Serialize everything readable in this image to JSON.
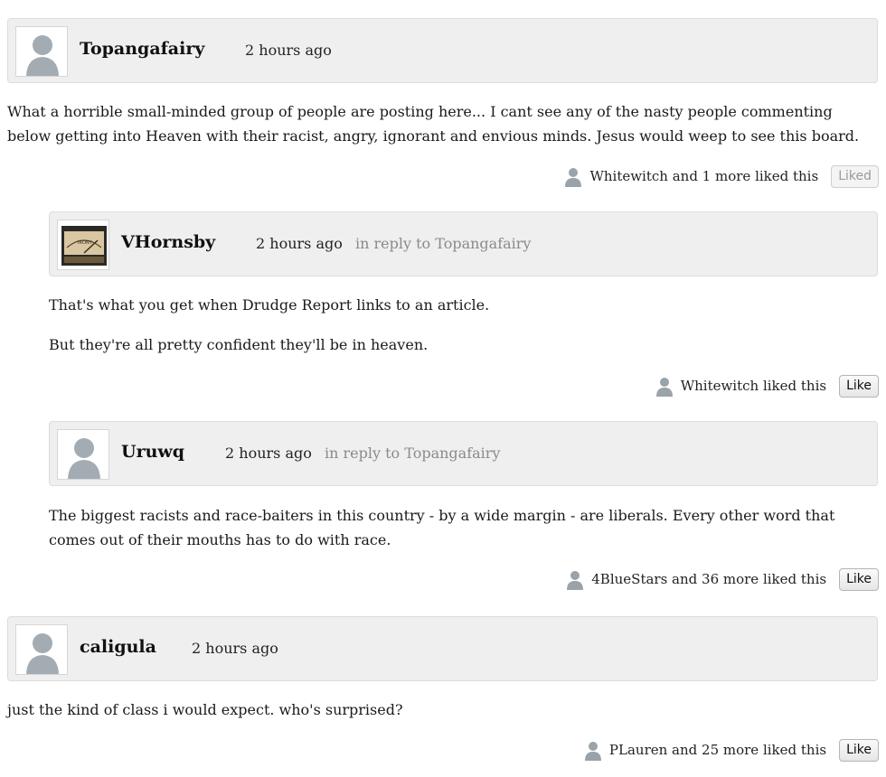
{
  "comments": [
    {
      "author": "Topangafairy",
      "time": "2 hours ago",
      "reply_to": "",
      "paragraphs": [
        "What a horrible small-minded  group of people are posting here...   I cant see any of the nasty people commenting below getting into Heaven with their racist, angry, ignorant and envious minds.   Jesus would weep to see this board."
      ],
      "likes_text": "Whitewitch and 1 more liked this",
      "like_button": "Liked",
      "avatar_icon": "default-avatar-icon"
    },
    {
      "author": "VHornsby",
      "time": "2 hours ago",
      "reply_to": "in reply to Topangafairy",
      "paragraphs": [
        "That's what you get when Drudge Report links to an article.",
        "But they're all pretty confident they'll be in heaven."
      ],
      "likes_text": "Whitewitch liked this",
      "like_button": "Like",
      "avatar_icon": "irony-meter-avatar",
      "avatar_text": "IRONY"
    },
    {
      "author": "Uruwq",
      "time": "2 hours ago",
      "reply_to": "in reply to Topangafairy",
      "paragraphs": [
        "The biggest racists and race-baiters in this country - by a wide margin - are liberals. Every other word that comes out of their mouths has to do with race."
      ],
      "likes_text": "4BlueStars and 36 more liked this",
      "like_button": "Like",
      "avatar_icon": "default-avatar-icon"
    },
    {
      "author": "caligula",
      "time": "2 hours ago",
      "reply_to": "",
      "paragraphs": [
        "just the kind of class i would expect. who's surprised?"
      ],
      "likes_text": "PLauren and 25 more liked this",
      "like_button": "Like",
      "avatar_icon": "default-avatar-icon"
    }
  ]
}
